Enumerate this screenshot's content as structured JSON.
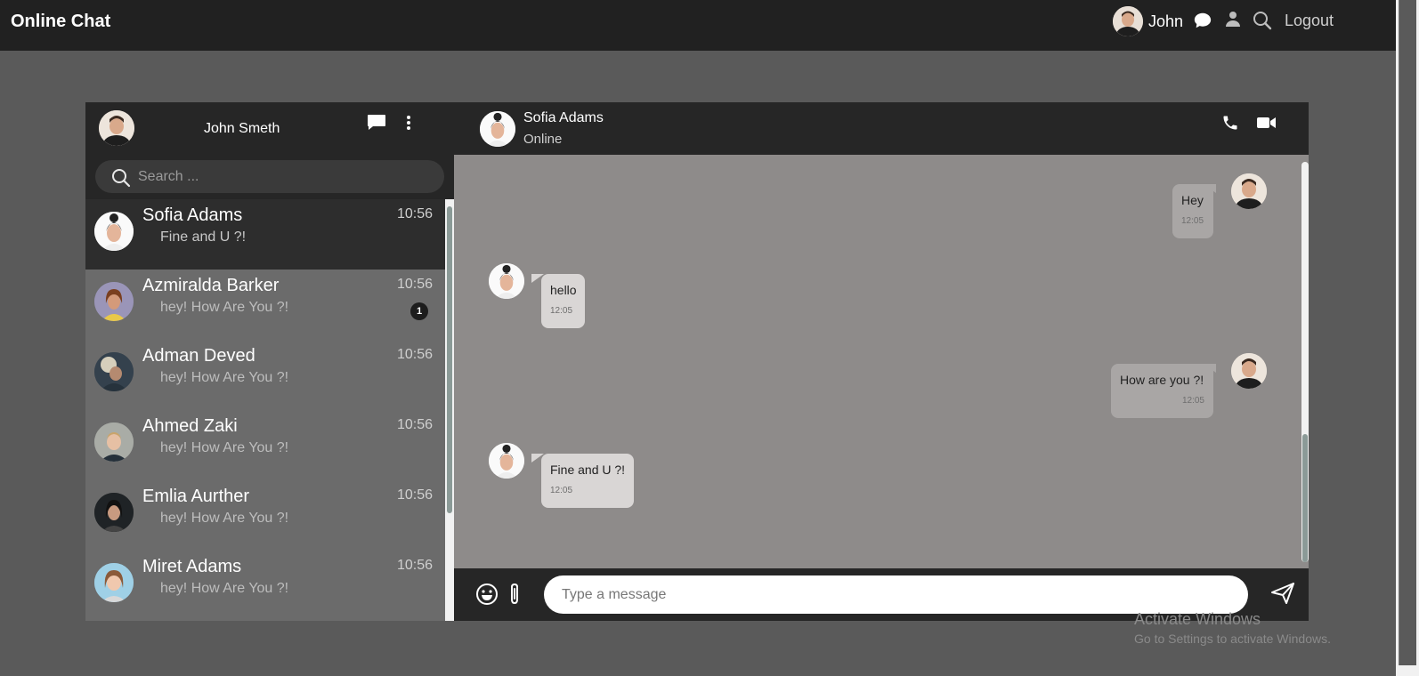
{
  "navbar": {
    "brand": "Online Chat",
    "username": "John",
    "logout_label": "Logout"
  },
  "sidebar": {
    "user_name": "John Smeth",
    "search_placeholder": "Search ...",
    "contacts": [
      {
        "name": "Sofia Adams",
        "time": "10:56",
        "last_message": "Fine and U ?!",
        "active": true
      },
      {
        "name": "Azmiralda Barker",
        "time": "10:56",
        "last_message": "hey! How Are You ?!",
        "unread": "1"
      },
      {
        "name": "Adman Deved",
        "time": "10:56",
        "last_message": "hey! How Are You ?!"
      },
      {
        "name": "Ahmed Zaki",
        "time": "10:56",
        "last_message": "hey! How Are You ?!"
      },
      {
        "name": "Emlia Aurther",
        "time": "10:56",
        "last_message": "hey! How Are You ?!"
      },
      {
        "name": "Miret Adams",
        "time": "10:56",
        "last_message": "hey! How Are You ?!"
      }
    ]
  },
  "chat": {
    "contact_name": "Sofia Adams",
    "contact_status": "Online",
    "messages": [
      {
        "direction": "out",
        "text": "Hey",
        "time": "12:05"
      },
      {
        "direction": "in",
        "text": "hello",
        "time": "12:05"
      },
      {
        "direction": "out",
        "text": "How are you ?!",
        "time": "12:05"
      },
      {
        "direction": "in",
        "text": "Fine and U ?!",
        "time": "12:05"
      }
    ],
    "composer_placeholder": "Type a message"
  },
  "watermark": {
    "title": "Activate Windows",
    "subtitle": "Go to Settings to activate Windows."
  },
  "colors": {
    "navbar_bg": "#212121",
    "page_bg": "#5a5a5a",
    "active_contact_bg": "#2d2d2d",
    "chat_bg": "#8e8b8a",
    "outgoing_bubble": "#a9a6a5",
    "incoming_bubble": "#d9d6d5"
  }
}
